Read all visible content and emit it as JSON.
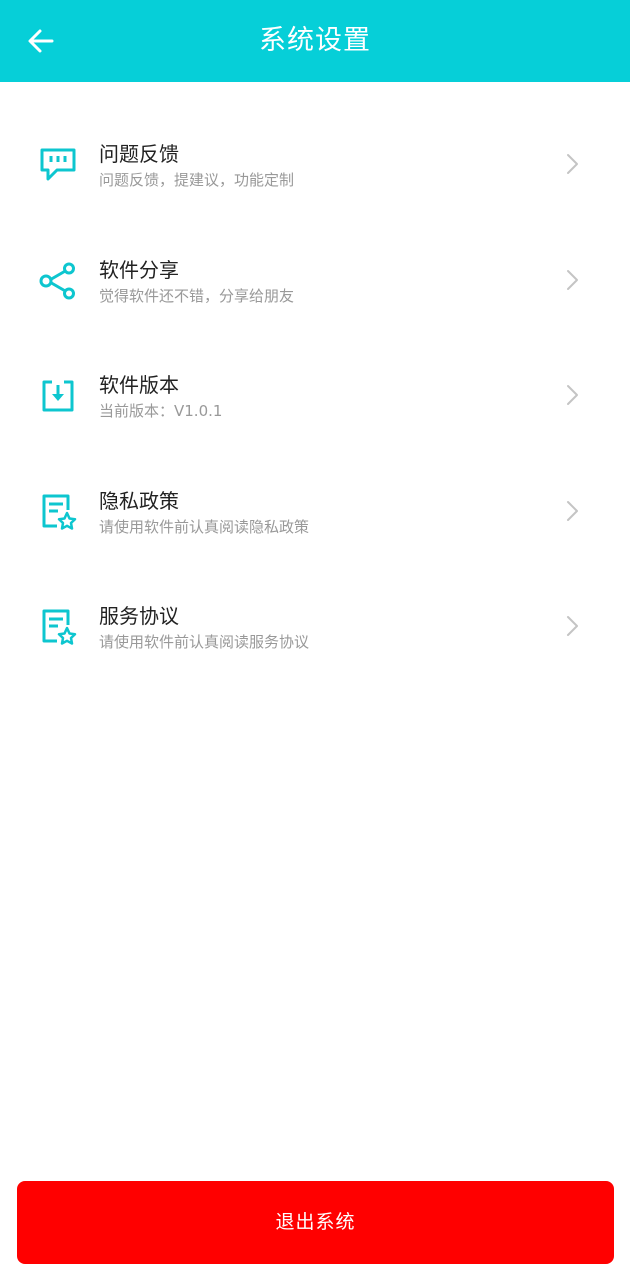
{
  "header": {
    "title": "系统设置",
    "back_icon": "arrow-left-icon"
  },
  "colors": {
    "header_bg": "#06CFD8",
    "accent": "#0DC6CF",
    "logout_bg": "#FF0000",
    "title_text": "#222222",
    "desc_text": "#999999",
    "chevron": "#C4C4C4"
  },
  "menu": {
    "items": [
      {
        "icon": "feedback-icon",
        "title": "问题反馈",
        "desc": "问题反馈，提建议，功能定制"
      },
      {
        "icon": "share-icon",
        "title": "软件分享",
        "desc": "觉得软件还不错，分享给朋友"
      },
      {
        "icon": "download-icon",
        "title": "软件版本",
        "desc": "当前版本：V1.0.1"
      },
      {
        "icon": "document-star-icon",
        "title": "隐私政策",
        "desc": "请使用软件前认真阅读隐私政策"
      },
      {
        "icon": "document-star-icon",
        "title": "服务协议",
        "desc": "请使用软件前认真阅读服务协议"
      }
    ]
  },
  "logout": {
    "label": "退出系统"
  }
}
